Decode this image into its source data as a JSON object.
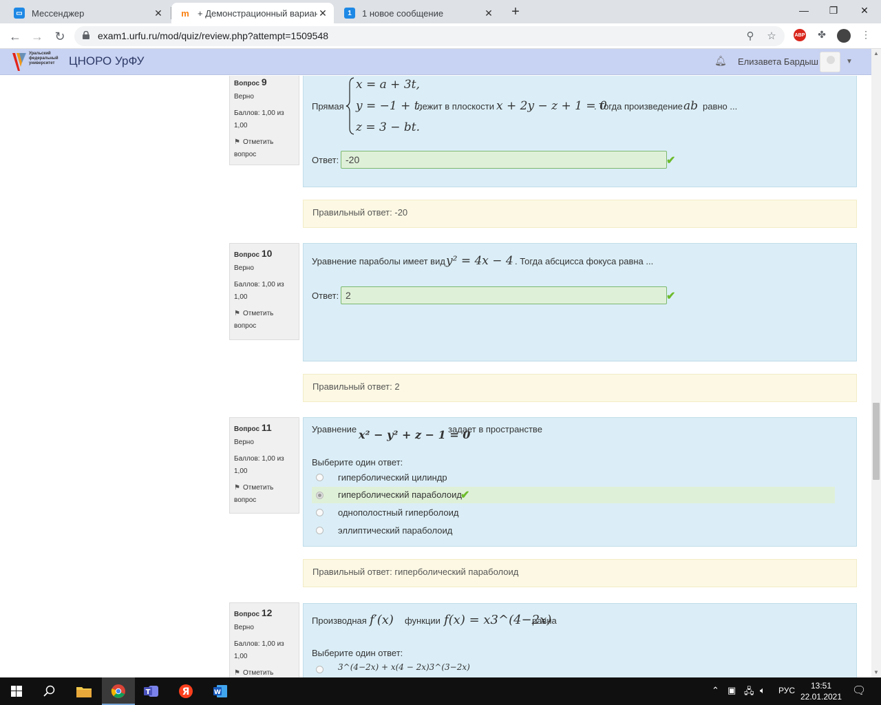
{
  "browser": {
    "tabs": [
      {
        "title": "Мессенджер",
        "favicon_color": "#1e88e5"
      },
      {
        "title": "+ Демонстрационный вариант",
        "favicon_color": "#f98012"
      },
      {
        "title": "1 новое сообщение",
        "favicon_color": "#1e88e5",
        "favicon_text": "1"
      }
    ],
    "url": "exam1.urfu.ru/mod/quiz/review.php?attempt=1509548",
    "abp_label": "ABP"
  },
  "header": {
    "logo_text": "Уральский федеральный университет",
    "site_name": "ЦНОРО УрФУ",
    "user_name": "Елизавета Бардыш"
  },
  "questions": [
    {
      "label": "Вопрос",
      "number": "9",
      "state": "Верно",
      "grade_line1": "Баллов: 1,00 из",
      "grade_line2": "1,00",
      "flag_line1": "Отметить",
      "flag_line2": "вопрос",
      "text_before": "Прямая",
      "system": [
        "x = a + 3t,",
        "y = −1 + t,",
        "z = 3 − bt."
      ],
      "text_mid": "лежит в плоскости",
      "formula_plane": "x + 2y − z + 1 = 0",
      "text_after": ". Тогда произведение",
      "formula_ab": "ab",
      "text_end": "равно ...",
      "answer_label": "Ответ:",
      "answer_value": "-20",
      "correct_answer": "Правильный ответ: -20"
    },
    {
      "label": "Вопрос",
      "number": "10",
      "state": "Верно",
      "grade_line1": "Баллов: 1,00 из",
      "grade_line2": "1,00",
      "flag_line1": "Отметить",
      "flag_line2": "вопрос",
      "text_before": "Уравнение параболы имеет вид",
      "formula": "y² = 4x − 4",
      "text_after": ". Тогда абсцисса фокуса равна ...",
      "answer_label": "Ответ:",
      "answer_value": "2",
      "correct_answer": "Правильный ответ: 2"
    },
    {
      "label": "Вопрос",
      "number": "11",
      "state": "Верно",
      "grade_line1": "Баллов: 1,00 из",
      "grade_line2": "1,00",
      "flag_line1": "Отметить",
      "flag_line2": "вопрос",
      "text_before": "Уравнение",
      "formula": "x² − y² + z − 1 = 0",
      "text_after": "задает в пространстве",
      "prompt": "Выберите один ответ:",
      "options": [
        "гиперболический цилиндр",
        "гиперболический параболоид",
        "однополостный гиперболоид",
        "эллиптический параболоид"
      ],
      "selected_index": 1,
      "correct_answer": "Правильный ответ: гиперболический параболоид"
    },
    {
      "label": "Вопрос",
      "number": "12",
      "state": "Верно",
      "grade_line1": "Баллов: 1,00 из",
      "grade_line2": "1,00",
      "flag_line1": "Отметить",
      "text_before": "Производная",
      "formula_fprime": "f′(x)",
      "text_mid": "функции",
      "formula_f": "f(x) = x3^(4−2x)",
      "text_after": "равна",
      "prompt": "Выберите один ответ:",
      "option1": "3^(4−2x) + x(4 − 2x)3^(3−2x)"
    }
  ],
  "taskbar": {
    "language": "РУС",
    "time": "13:51",
    "date": "22.01.2021"
  }
}
